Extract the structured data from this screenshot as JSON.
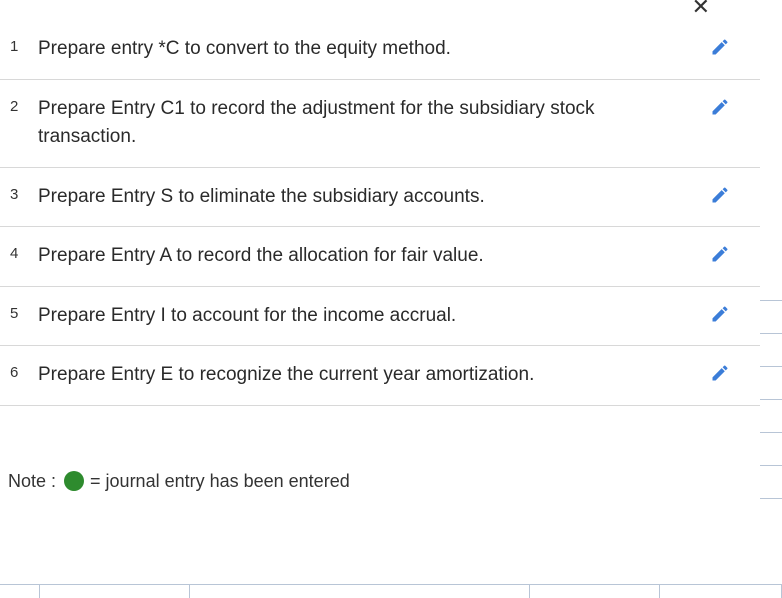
{
  "close_label": "✕",
  "rows": [
    {
      "num": "1",
      "text": "Prepare entry *C to convert to the equity method."
    },
    {
      "num": "2",
      "text": "Prepare Entry C1 to record the adjustment for the subsidiary stock transaction."
    },
    {
      "num": "3",
      "text": "Prepare Entry S to eliminate the subsidiary accounts."
    },
    {
      "num": "4",
      "text": "Prepare Entry A to record the allocation for fair value."
    },
    {
      "num": "5",
      "text": "Prepare Entry I to account for the income accrual."
    },
    {
      "num": "6",
      "text": "Prepare Entry E to recognize the current year amortization."
    }
  ],
  "note": {
    "label": "Note :",
    "text": " = journal entry has been entered",
    "dot_color": "#2e8b2e"
  },
  "icon_color": "#3b7dd8"
}
